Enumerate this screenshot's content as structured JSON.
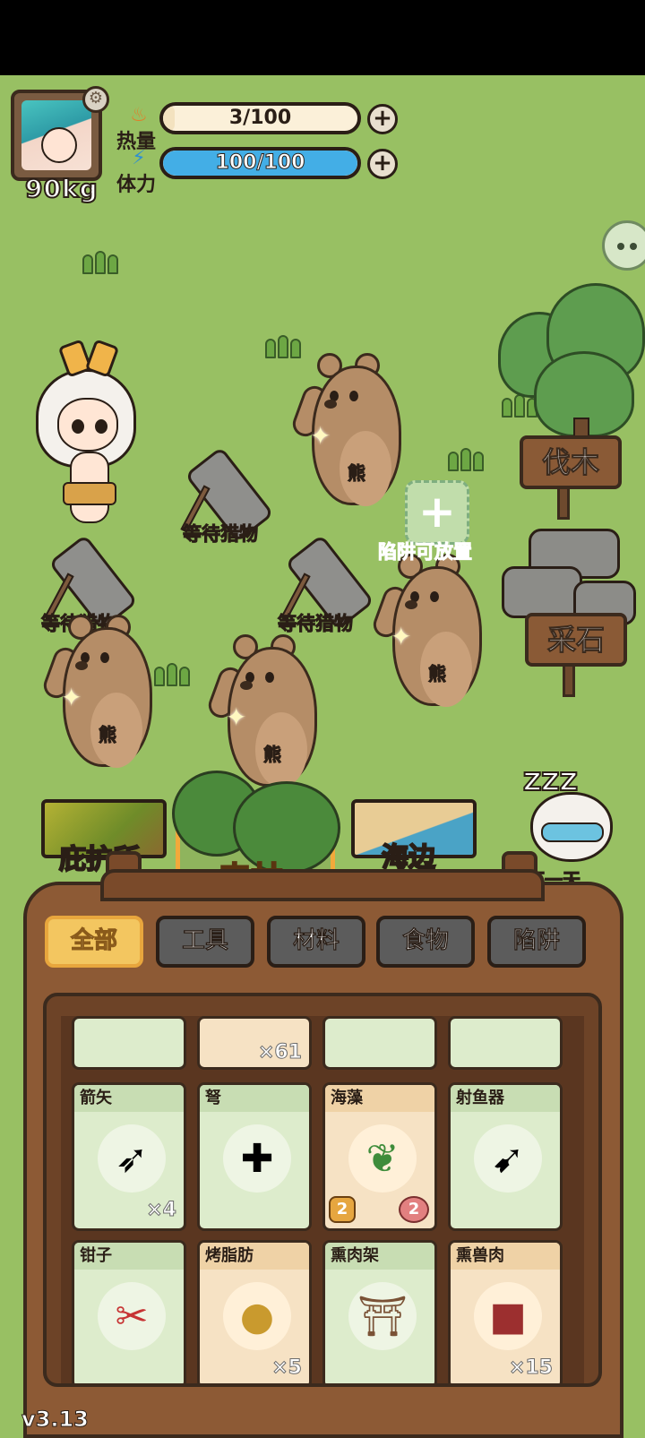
{
  "player": {
    "weight": "90kg",
    "calories_label": "热量",
    "calories_text": "3/100",
    "calories_fill": 0.03,
    "stamina_label": "体力",
    "stamina_text": "100/100",
    "stamina_fill": 1.0
  },
  "scene": {
    "traps": [
      {
        "label": "等待猎物"
      },
      {
        "label": "等待猎物"
      },
      {
        "label": "等待猎物"
      }
    ],
    "bears": [
      {
        "label": "熊"
      },
      {
        "label": "熊"
      },
      {
        "label": "熊"
      },
      {
        "label": "熊"
      }
    ],
    "trap_slot_label": "陷阱可放置",
    "signs": {
      "chop": "伐木",
      "quarry": "采石"
    }
  },
  "locations": {
    "shelter": "庇护所",
    "forest": "森林",
    "seaside": "海边",
    "next_day": "下一天",
    "zzz": "ZZZ"
  },
  "tabs": {
    "all": "全部",
    "tools": "工具",
    "materials": "材料",
    "food": "食物",
    "traps": "陷阱"
  },
  "inventory": {
    "top_row": [
      {
        "qty": ""
      },
      {
        "qty": "×61"
      },
      {
        "qty": ""
      },
      {
        "qty": ""
      }
    ],
    "row2": [
      {
        "name": "箭矢",
        "icon": "arrow-icon",
        "qty": "×4"
      },
      {
        "name": "弩",
        "icon": "crossbow-icon",
        "qty": ""
      },
      {
        "name": "海藻",
        "icon": "seaweed-icon",
        "qty": "",
        "badge_left": "2",
        "badge_right": "2"
      },
      {
        "name": "射鱼器",
        "icon": "fish-gun-icon",
        "qty": ""
      }
    ],
    "row3": [
      {
        "name": "钳子",
        "icon": "pliers-icon",
        "qty": ""
      },
      {
        "name": "烤脂肪",
        "icon": "roasted-fat-icon",
        "qty": "×5"
      },
      {
        "name": "熏肉架",
        "icon": "smoking-rack-icon",
        "qty": ""
      },
      {
        "name": "熏兽肉",
        "icon": "smoked-meat-icon",
        "qty": "×15"
      }
    ]
  },
  "version": "v3.13",
  "colors": {
    "grass": "#98c063",
    "calorie_bar": "#f3e2bf",
    "stamina_bar": "#43aee6",
    "active_tab": "#f3c660",
    "forest_label": "#f7b23b",
    "trap_slot_label": "#d43a2f"
  }
}
